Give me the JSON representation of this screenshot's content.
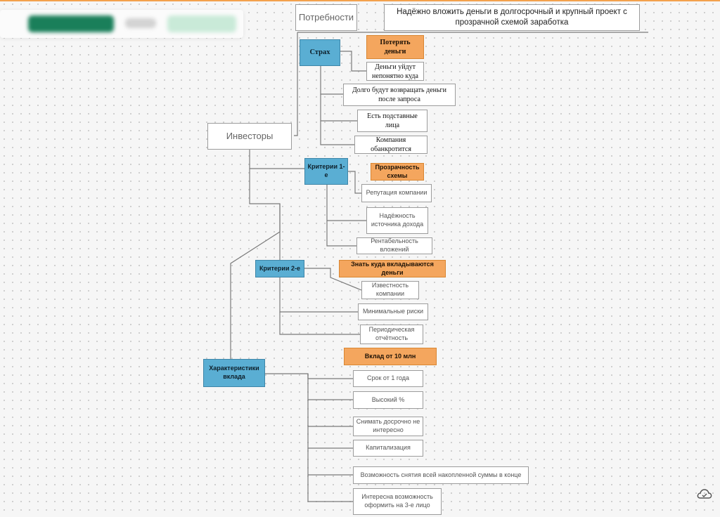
{
  "diagram": {
    "needs_label": "Потребности",
    "main_goal": "Надёжно вложить деньги в долгосрочный и крупный проект с прозрачной схемой заработка",
    "root": "Инвесторы",
    "groups": [
      {
        "label": "Страх",
        "highlight": "Потерять деньги",
        "items": [
          "Деньги уйдут непонятно куда",
          "Долго будут возвращать деньги после запроса",
          "Есть подставные лица",
          "Компания обанкротится"
        ]
      },
      {
        "label": "Критерии 1-е",
        "highlight": "Прозрачность схемы",
        "items": [
          "Репутация компании",
          "Надёжность источника дохода",
          "Рентабельность вложений"
        ]
      },
      {
        "label": "Критерии 2-е",
        "highlight": "Знать куда вкладываются деньги",
        "items": [
          "Известность компании",
          "Минимальные риски",
          "Периодическая отчётность"
        ]
      },
      {
        "label": "Характеристики вклада",
        "highlight": "Вклад от 10 млн",
        "items": [
          "Срок от 1 года",
          "Высокий %",
          "Снимать досрочно не интересно",
          "Капитализация",
          "Возможность снятия всей накопленной суммы в конце",
          "Интересна возможность оформить на 3-е лицо"
        ]
      }
    ]
  },
  "colors": {
    "category": "#5aaed3",
    "highlight": "#f4a65e",
    "connector": "#7a7a7a"
  },
  "icons": {
    "cloud_status": "cloud-sync-icon"
  }
}
